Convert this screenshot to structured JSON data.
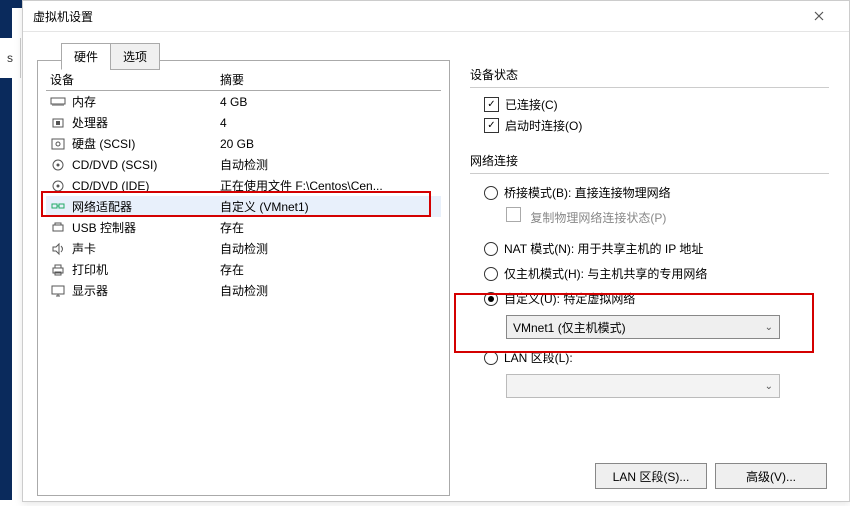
{
  "title": "虚拟机设置",
  "tabs": {
    "hardware": "硬件",
    "options": "选项"
  },
  "device_header": {
    "device": "设备",
    "summary": "摘要"
  },
  "devices": [
    {
      "icon": "memory",
      "name": "内存",
      "summary": "4 GB"
    },
    {
      "icon": "cpu",
      "name": "处理器",
      "summary": "4"
    },
    {
      "icon": "disk",
      "name": "硬盘 (SCSI)",
      "summary": "20 GB"
    },
    {
      "icon": "cd",
      "name": "CD/DVD (SCSI)",
      "summary": "自动检测"
    },
    {
      "icon": "cd",
      "name": "CD/DVD (IDE)",
      "summary": "正在使用文件 F:\\Centos\\Cen..."
    },
    {
      "icon": "net",
      "name": "网络适配器",
      "summary": "自定义 (VMnet1)",
      "selected": true
    },
    {
      "icon": "usb",
      "name": "USB 控制器",
      "summary": "存在"
    },
    {
      "icon": "sound",
      "name": "声卡",
      "summary": "自动检测"
    },
    {
      "icon": "print",
      "name": "打印机",
      "summary": "存在"
    },
    {
      "icon": "display",
      "name": "显示器",
      "summary": "自动检测"
    }
  ],
  "right": {
    "status_label": "设备状态",
    "connected": "已连接(C)",
    "connect_on": "启动时连接(O)",
    "net_label": "网络连接",
    "bridge": "桥接模式(B): 直接连接物理网络",
    "bridge_sub": "复制物理网络连接状态(P)",
    "nat": "NAT 模式(N): 用于共享主机的 IP 地址",
    "hostonly": "仅主机模式(H): 与主机共享的专用网络",
    "custom": "自定义(U): 特定虚拟网络",
    "custom_select": "VMnet1 (仅主机模式)",
    "lan": "LAN 区段(L):",
    "btn_lan": "LAN 区段(S)...",
    "btn_adv": "高级(V)..."
  }
}
